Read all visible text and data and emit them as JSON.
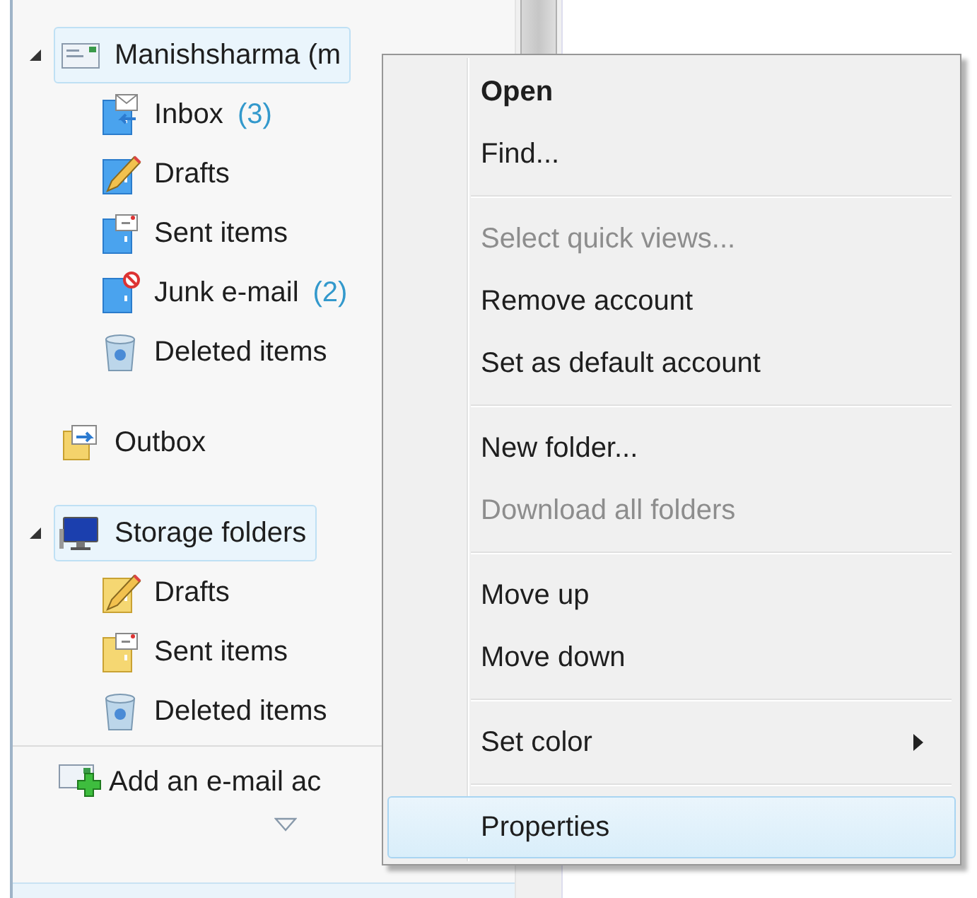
{
  "folders": [
    {
      "name": "Manishsharma (m",
      "kind": "account",
      "expanded": true,
      "selected": true,
      "children": [
        {
          "name": "Inbox",
          "count": "(3)",
          "kind": "inbox",
          "selected": false
        },
        {
          "name": "Drafts",
          "kind": "drafts",
          "selected": false
        },
        {
          "name": "Sent items",
          "kind": "sent",
          "selected": false
        },
        {
          "name": "Junk e-mail",
          "count": "(2)",
          "kind": "junk",
          "selected": false
        },
        {
          "name": "Deleted items",
          "kind": "deleted",
          "selected": false
        }
      ]
    },
    {
      "name": "Outbox",
      "kind": "outbox",
      "selected": false
    },
    {
      "name": "Storage folders",
      "kind": "storage",
      "expanded": true,
      "selected": true,
      "children": [
        {
          "name": "Drafts",
          "kind": "drafts",
          "selected": false
        },
        {
          "name": "Sent items",
          "kind": "sent",
          "selected": false
        },
        {
          "name": "Deleted items",
          "kind": "deleted",
          "selected": false
        }
      ]
    }
  ],
  "add_account": {
    "label": "Add an e-mail ac"
  },
  "context_menu": [
    {
      "kind": "item",
      "label": "Open",
      "bold": true,
      "disabled": false,
      "selected": false
    },
    {
      "kind": "item",
      "label": "Find...",
      "disabled": false,
      "selected": false
    },
    {
      "kind": "separator"
    },
    {
      "kind": "item",
      "label": "Select quick views...",
      "disabled": true,
      "selected": false
    },
    {
      "kind": "item",
      "label": "Remove account",
      "disabled": false,
      "selected": false
    },
    {
      "kind": "item",
      "label": "Set as default account",
      "disabled": false,
      "selected": false
    },
    {
      "kind": "separator"
    },
    {
      "kind": "item",
      "label": "New folder...",
      "disabled": false,
      "selected": false
    },
    {
      "kind": "item",
      "label": "Download all folders",
      "disabled": true,
      "selected": false
    },
    {
      "kind": "separator"
    },
    {
      "kind": "item",
      "label": "Move up",
      "disabled": false,
      "selected": false
    },
    {
      "kind": "item",
      "label": "Move down",
      "disabled": false,
      "selected": false
    },
    {
      "kind": "separator"
    },
    {
      "kind": "item",
      "label": "Set color",
      "disabled": false,
      "selected": false,
      "submenu": true
    },
    {
      "kind": "separator"
    },
    {
      "kind": "item",
      "label": "Properties",
      "disabled": false,
      "selected": true
    }
  ]
}
